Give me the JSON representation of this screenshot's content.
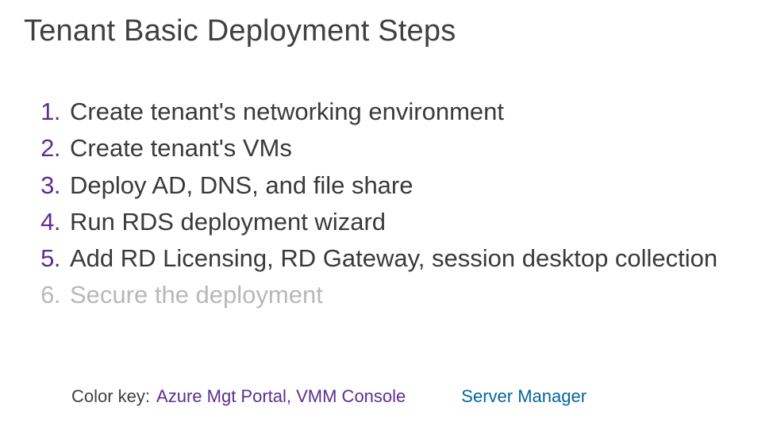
{
  "title": "Tenant Basic Deployment Steps",
  "steps": [
    {
      "num": "1.",
      "text": "Create tenant's networking environment",
      "color": "purple"
    },
    {
      "num": "2.",
      "text": "Create tenant's VMs",
      "color": "purple"
    },
    {
      "num": "3.",
      "text": "Deploy AD, DNS, and file share",
      "color": "purple"
    },
    {
      "num": "4.",
      "text": "Run RDS deployment wizard",
      "color": "purple"
    },
    {
      "num": "5.",
      "text": "Add RD Licensing, RD Gateway, session desktop collection",
      "color": "purple"
    },
    {
      "num": "6.",
      "text": "Secure the deployment",
      "color": "gray"
    }
  ],
  "legend": {
    "label": "Color key:",
    "purple_text": "Azure Mgt Portal, VMM Console",
    "blue_text": "Server Manager"
  }
}
